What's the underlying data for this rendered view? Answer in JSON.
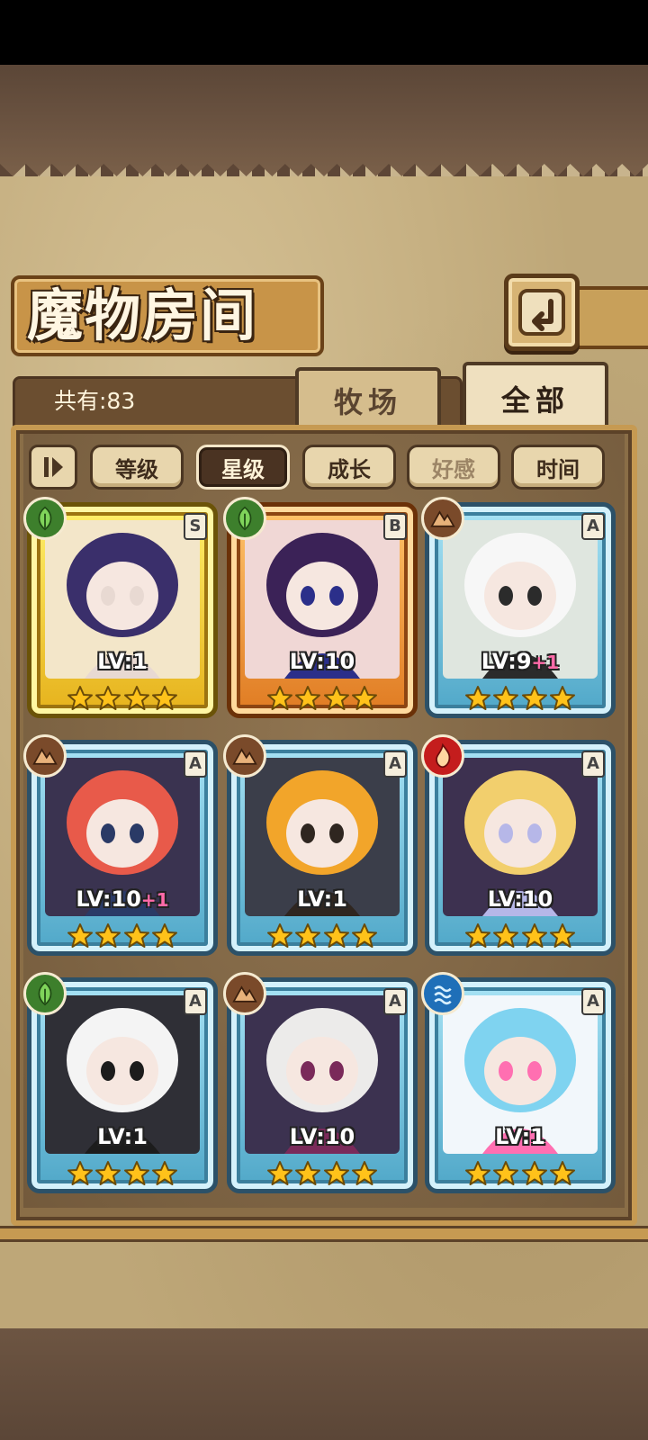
{
  "screen": {
    "title": "魔物房间",
    "return_icon": "return-arrow-icon"
  },
  "tabs": {
    "count_label": "共有:83",
    "items": [
      {
        "label": "牧场",
        "active": false
      },
      {
        "label": "全部",
        "active": true
      }
    ]
  },
  "sort": {
    "toggle_icon": "sort-order-icon",
    "buttons": [
      {
        "label": "等级",
        "state": "normal"
      },
      {
        "label": "星级",
        "state": "selected"
      },
      {
        "label": "成长",
        "state": "normal"
      },
      {
        "label": "好感",
        "state": "disabled"
      },
      {
        "label": "时间",
        "state": "normal"
      }
    ]
  },
  "monsters": [
    {
      "element": "leaf",
      "rank": "S",
      "level": "LV:1",
      "bonus": "",
      "stars": 4,
      "frame": "gold",
      "palette": [
        "#f3e6c9",
        "#3a2f6b",
        "#e8d9d2"
      ]
    },
    {
      "element": "leaf",
      "rank": "B",
      "level": "LV:10",
      "bonus": "",
      "stars": 4,
      "frame": "orange",
      "palette": [
        "#f0d7d5",
        "#3b2257",
        "#2b2f8a"
      ]
    },
    {
      "element": "rock",
      "rank": "A",
      "level": "LV:9",
      "bonus": "+1",
      "stars": 4,
      "frame": "blue",
      "palette": [
        "#dfe6df",
        "#f7f7f7",
        "#2b2b2b"
      ]
    },
    {
      "element": "rock",
      "rank": "A",
      "level": "LV:10",
      "bonus": "+1",
      "stars": 4,
      "frame": "blue",
      "palette": [
        "#3a3350",
        "#e85a4a",
        "#2a3a66"
      ]
    },
    {
      "element": "rock",
      "rank": "A",
      "level": "LV:1",
      "bonus": "",
      "stars": 4,
      "frame": "blue",
      "palette": [
        "#3b3e4a",
        "#f2a52a",
        "#2f2620"
      ]
    },
    {
      "element": "fire",
      "rank": "A",
      "level": "LV:10",
      "bonus": "",
      "stars": 4,
      "frame": "blue",
      "palette": [
        "#3d3150",
        "#f2cf6d",
        "#b6b7e8"
      ]
    },
    {
      "element": "leaf",
      "rank": "A",
      "level": "LV:1",
      "bonus": "",
      "stars": 4,
      "frame": "blue",
      "palette": [
        "#2f2f36",
        "#f4f4f4",
        "#1c1c1c"
      ]
    },
    {
      "element": "rock",
      "rank": "A",
      "level": "LV:10",
      "bonus": "",
      "stars": 4,
      "frame": "blue",
      "palette": [
        "#3c3250",
        "#ecebea",
        "#7a2a5a"
      ]
    },
    {
      "element": "water",
      "rank": "A",
      "level": "LV:1",
      "bonus": "",
      "stars": 4,
      "frame": "blue",
      "palette": [
        "#f2f7fb",
        "#7fd3f0",
        "#ff6fb1"
      ]
    }
  ],
  "colors": {
    "parchment": "#bea778",
    "panel": "#8a6e47",
    "accent_gold": "#c69a52",
    "star_yellow": "#ffc21a"
  }
}
